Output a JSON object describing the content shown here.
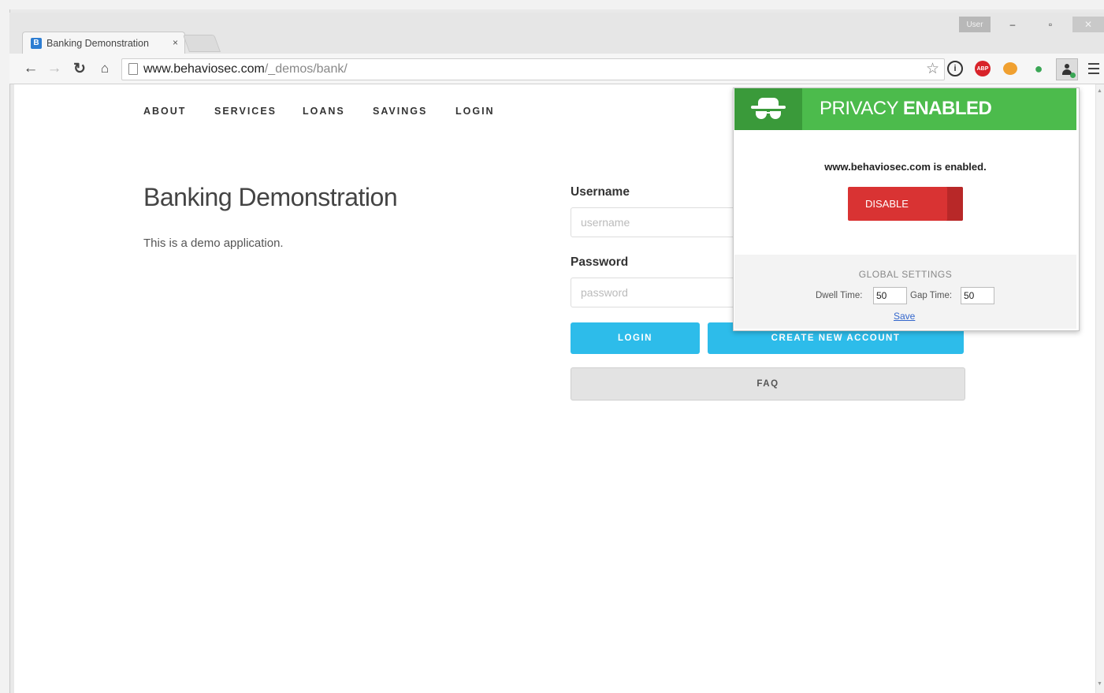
{
  "browser": {
    "tab_title": "Banking Demonstration",
    "tab_close": "×",
    "favicon_letter": "B",
    "url_domain": "www.behaviosec.com",
    "url_path": "/_demos/bank/",
    "window_user": "User",
    "minimize": "–",
    "maximize": "▫",
    "close": "✕"
  },
  "toolbar_icons": [
    "back-icon",
    "forward-icon",
    "reload-icon",
    "home-icon",
    "star-icon",
    "info-icon",
    "adblock-icon",
    "pumpkin-icon",
    "pin-icon",
    "privacy-extension-icon",
    "menu-icon"
  ],
  "nav": {
    "items": [
      "ABOUT",
      "SERVICES",
      "LOANS",
      "SAVINGS",
      "LOGIN"
    ]
  },
  "main": {
    "heading": "Banking Demonstration",
    "description": "This is a demo application."
  },
  "form": {
    "username_label": "Username",
    "username_placeholder": "username",
    "password_label": "Password",
    "password_placeholder": "password",
    "login_button": "LOGIN",
    "create_button": "CREATE NEW ACCOUNT",
    "faq_button": "FAQ"
  },
  "popup": {
    "title_prefix": "PRIVACY",
    "title_status": "ENABLED",
    "message": "www.behaviosec.com is enabled.",
    "disable_button": "DISABLE",
    "global_settings": "GLOBAL SETTINGS",
    "dwell_label": "Dwell Time:",
    "dwell_value": "50",
    "gap_label": "Gap Time:",
    "gap_value": "50",
    "save_link": "Save"
  },
  "colors": {
    "accent_blue": "#2dbcea",
    "privacy_green": "#4cbb4c",
    "disable_red": "#d93333"
  }
}
